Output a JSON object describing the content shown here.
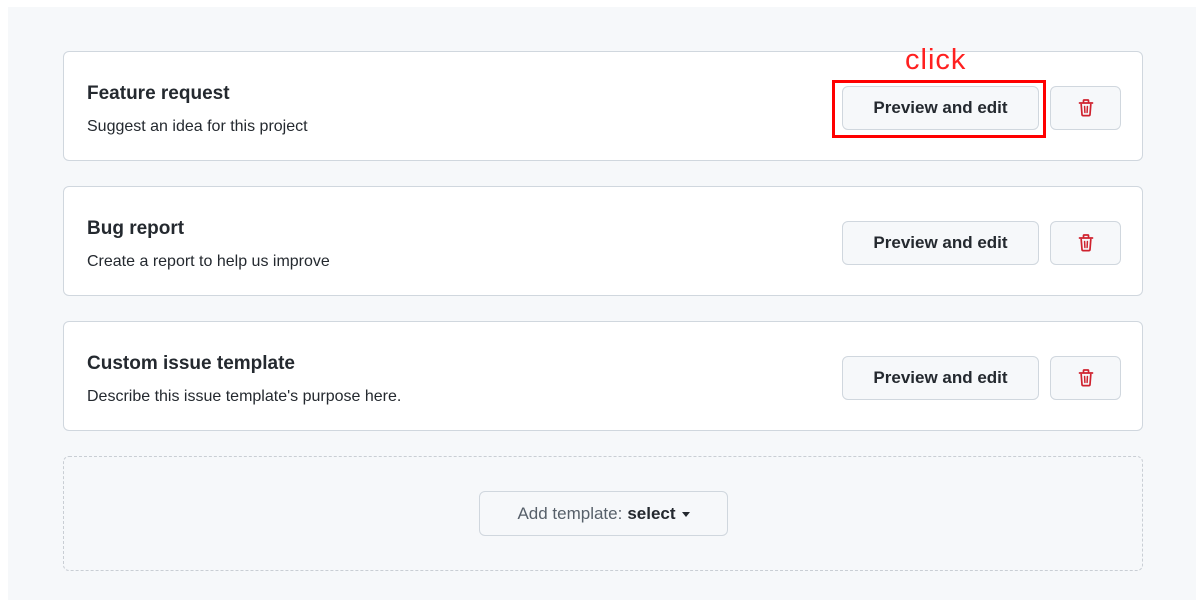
{
  "templates": [
    {
      "title": "Feature request",
      "description": "Suggest an idea for this project",
      "preview_label": "Preview and edit",
      "delete_icon": "trash-icon"
    },
    {
      "title": "Bug report",
      "description": "Create a report to help us improve",
      "preview_label": "Preview and edit",
      "delete_icon": "trash-icon"
    },
    {
      "title": "Custom issue template",
      "description": "Describe this issue template's purpose here.",
      "preview_label": "Preview and edit",
      "delete_icon": "trash-icon"
    }
  ],
  "add_template": {
    "prefix": "Add template:",
    "selected": "select"
  },
  "annotation": {
    "label": "click",
    "color": "#ff0000"
  },
  "colors": {
    "page_background": "#f6f8fa",
    "card_border": "#d0d7de",
    "danger": "#cf222e",
    "text": "#24292f"
  }
}
